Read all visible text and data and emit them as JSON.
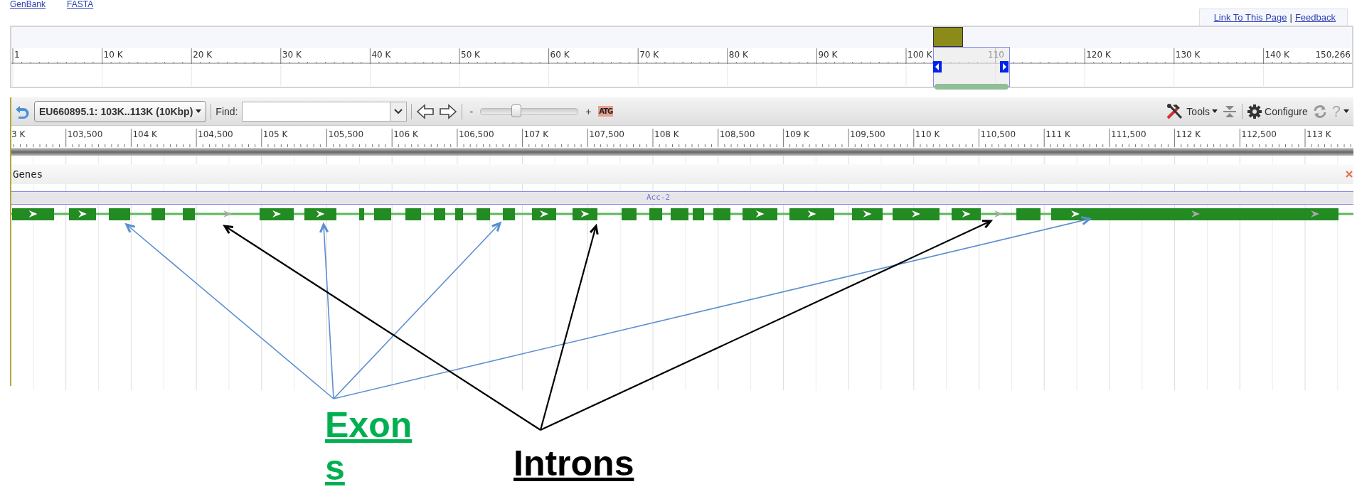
{
  "header_links": [
    {
      "label": "GenBank"
    },
    {
      "label": "FASTA"
    }
  ],
  "page_links": {
    "items": [
      {
        "label": "Link To This Page"
      },
      {
        "label": "Feedback"
      }
    ],
    "separator": "|"
  },
  "overview": {
    "ticks": [
      "1",
      "10 K",
      "20 K",
      "30 K",
      "40 K",
      "50 K",
      "60 K",
      "70 K",
      "80 K",
      "90 K",
      "100 K",
      "120 K",
      "130 K",
      "140 K"
    ],
    "end_label": "150,266",
    "highlight_label": "110"
  },
  "toolbar": {
    "location": "EU660895.1: 103K..113K (10Kbp)",
    "find_label": "Find:",
    "zoom_out": "-",
    "zoom_slider": {
      "level": 0.37
    },
    "zoom_in": "+",
    "sequence_label": "ATG",
    "tools": "Tools",
    "configure": "Configure",
    "help": "?"
  },
  "detail_ruler": {
    "ticks": [
      "3 K",
      "103,500",
      "104 K",
      "104,500",
      "105 K",
      "105,500",
      "106 K",
      "106,500",
      "107 K",
      "107,500",
      "108 K",
      "108,500",
      "109 K",
      "109,500",
      "110 K",
      "110,500",
      "111 K",
      "111,500",
      "112 K",
      "112,500",
      "113 K"
    ]
  },
  "tracks": [
    {
      "label": "Genes",
      "features": [
        {
          "name": "Acc-2"
        }
      ]
    }
  ],
  "annotations": [
    {
      "label": "Exons",
      "kind": "exons"
    },
    {
      "label": "Introns",
      "kind": "introns"
    }
  ]
}
